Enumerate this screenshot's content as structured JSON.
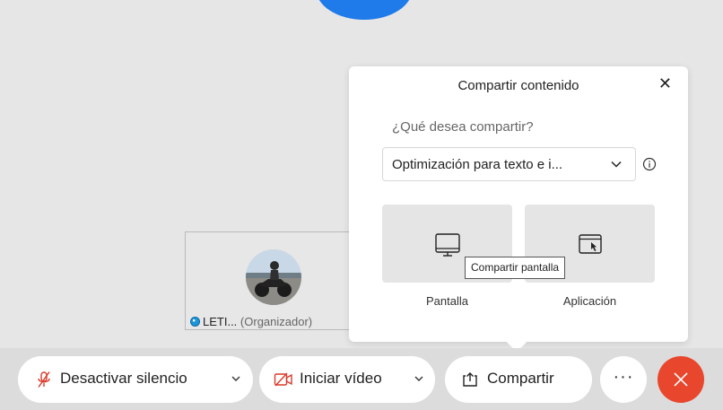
{
  "share_dialog": {
    "title": "Compartir contenido",
    "close_glyph": "✕",
    "question": "¿Qué desea compartir?",
    "optimization_value": "Optimización para texto e i...",
    "options": [
      {
        "label": "Pantalla",
        "icon": "monitor-icon"
      },
      {
        "label": "Aplicación",
        "icon": "application-window-icon"
      }
    ],
    "tooltip": "Compartir pantalla"
  },
  "participant": {
    "name": "LETI...",
    "role": "(Organizador)"
  },
  "toolbar": {
    "mute_label": "Desactivar silencio",
    "video_label": "Iniciar vídeo",
    "share_label": "Compartir",
    "more_label": "···"
  },
  "colors": {
    "accent_blue": "#1f7bea",
    "leave_red": "#e8462d",
    "muted_icon_red": "#d93a2b"
  }
}
